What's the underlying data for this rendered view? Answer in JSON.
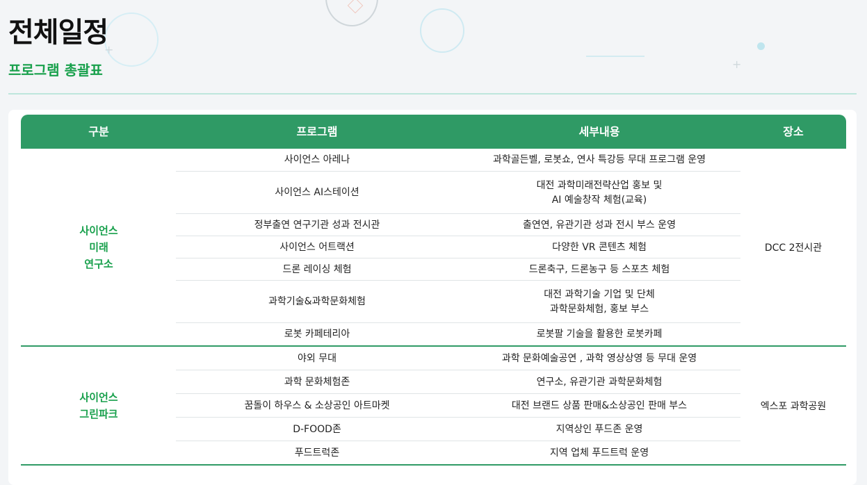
{
  "page": {
    "title": "전체일정",
    "subtitle": "프로그램 총괄표"
  },
  "table": {
    "headers": [
      "구분",
      "프로그램",
      "세부내용",
      "장소"
    ],
    "sections": [
      {
        "category_lines": [
          "사이언스",
          "미래",
          "연구소"
        ],
        "venue": "DCC 2전시관",
        "rows": [
          {
            "program": "사이언스 아레나",
            "details": [
              "과학골든벨, 로봇쇼, 연사 특강등 무대 프로그램 운영"
            ]
          },
          {
            "program": "사이언스 AI스테이션",
            "details": [
              "대전 과학미래전략산업 홍보 및",
              "AI 예술창작 체험(교육)"
            ]
          },
          {
            "program": "정부출연 연구기관 성과 전시관",
            "details": [
              "출연연, 유관기관 성과 전시 부스 운영"
            ]
          },
          {
            "program": "사이언스 어트랙션",
            "details": [
              "다양한 VR 콘텐츠 체험"
            ]
          },
          {
            "program": "드론 레이싱 체험",
            "details": [
              "드론축구, 드론농구 등 스포츠 체험"
            ]
          },
          {
            "program": "과학기술&과학문화체험",
            "details": [
              "대전 과학기술 기업 및 단체",
              "과학문화체험, 홍보 부스"
            ]
          },
          {
            "program": "로봇 카페테리아",
            "details": [
              "로봇팔 기술을 활용한 로봇카페"
            ]
          }
        ]
      },
      {
        "category_lines": [
          "사이언스",
          "그린파크"
        ],
        "venue": "엑스포 과학공원",
        "rows": [
          {
            "program": "야외 무대",
            "details": [
              "과학 문화예술공연 , 과학 영상상영 등 무대 운영"
            ]
          },
          {
            "program": "과학 문화체험존",
            "details": [
              "연구소, 유관기관 과학문화체험"
            ]
          },
          {
            "program": "꿈돌이 하우스 & 소상공인 아트마켓",
            "details": [
              "대전 브랜드 상품 판매&소상공인 판매 부스"
            ]
          },
          {
            "program": "D-FOOD존",
            "details": [
              "지역상인 푸드존 운영"
            ]
          },
          {
            "program": "푸드트럭존",
            "details": [
              "지역 업체 푸드트럭 운영"
            ]
          }
        ]
      }
    ]
  },
  "colors": {
    "accent_green": "#2f9a65",
    "category_green": "#18a04c",
    "header_text": "#ffffff"
  }
}
